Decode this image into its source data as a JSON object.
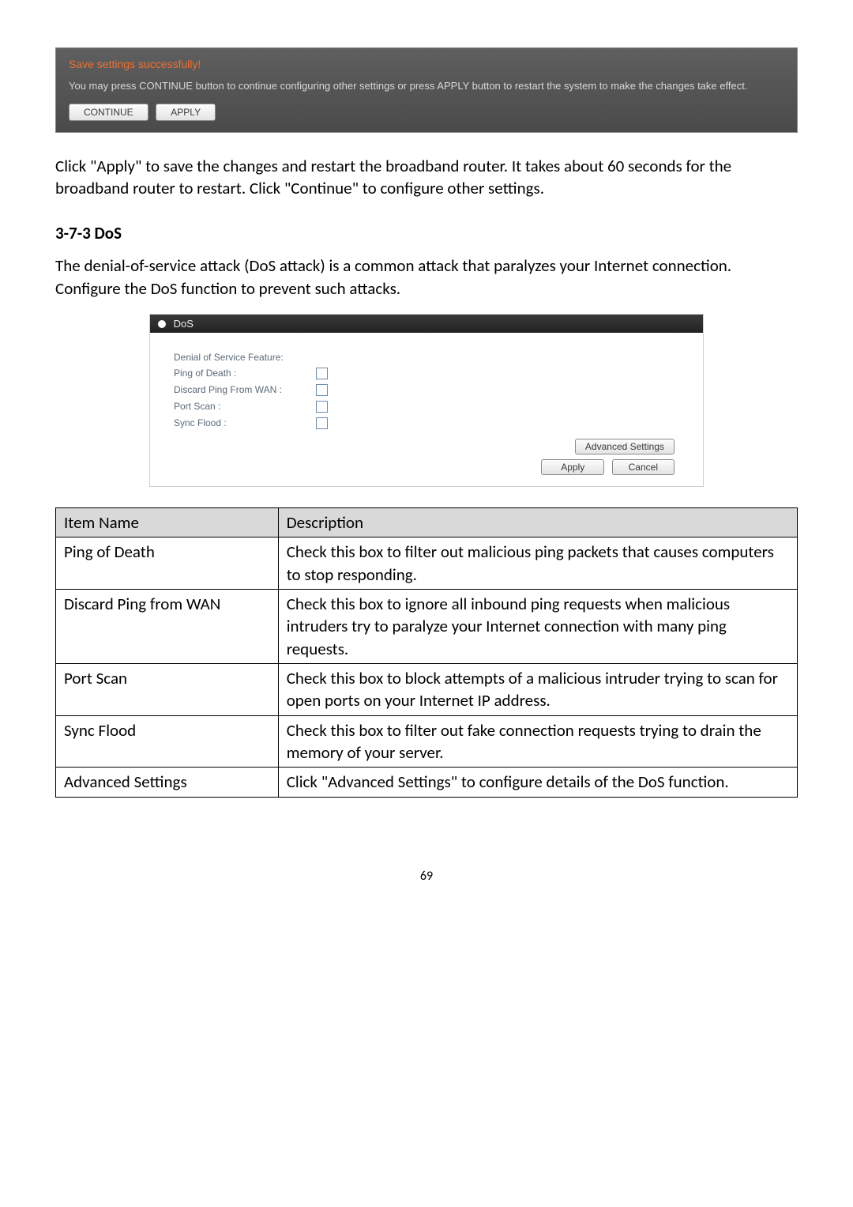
{
  "save_panel": {
    "title": "Save settings successfully!",
    "desc": "You may press CONTINUE button to continue configuring other settings or press APPLY button to restart the system to make the changes take effect.",
    "continue_btn": "CONTINUE",
    "apply_btn": "APPLY"
  },
  "para1": "Click \"Apply\" to save the changes and restart the broadband router. It takes about 60 seconds for the broadband router to restart. Click \"Continue\" to configure other settings.",
  "heading": "3-7-3 DoS",
  "para2": "The denial-of-service attack (DoS attack) is a common attack that paralyzes your Internet connection. Configure the DoS function to prevent such attacks.",
  "dos_panel": {
    "header": "DoS",
    "feature_label": "Denial of Service Feature:",
    "rows": [
      {
        "label": "Ping of Death :"
      },
      {
        "label": "Discard Ping From WAN :"
      },
      {
        "label": "Port Scan :"
      },
      {
        "label": "Sync Flood :"
      }
    ],
    "advanced_btn": "Advanced Settings",
    "apply_btn": "Apply",
    "cancel_btn": "Cancel"
  },
  "table": {
    "header_item": "Item Name",
    "header_desc": "Description",
    "rows": [
      {
        "item": "Ping of Death",
        "desc": "Check this box to filter out malicious ping packets that causes computers to stop responding."
      },
      {
        "item": "Discard Ping from WAN",
        "desc": "Check this box to ignore all inbound ping requests when malicious intruders try to paralyze your Internet connection with many ping requests."
      },
      {
        "item": "Port Scan",
        "desc": "Check this box to block attempts of a malicious intruder trying to scan for open ports on your Internet IP address."
      },
      {
        "item": "Sync Flood",
        "desc": "Check this box to filter out fake connection requests trying to drain the memory of your server."
      },
      {
        "item": "Advanced Settings",
        "desc": "Click \"Advanced Settings\" to configure details of the DoS function."
      }
    ]
  },
  "page_number": "69"
}
